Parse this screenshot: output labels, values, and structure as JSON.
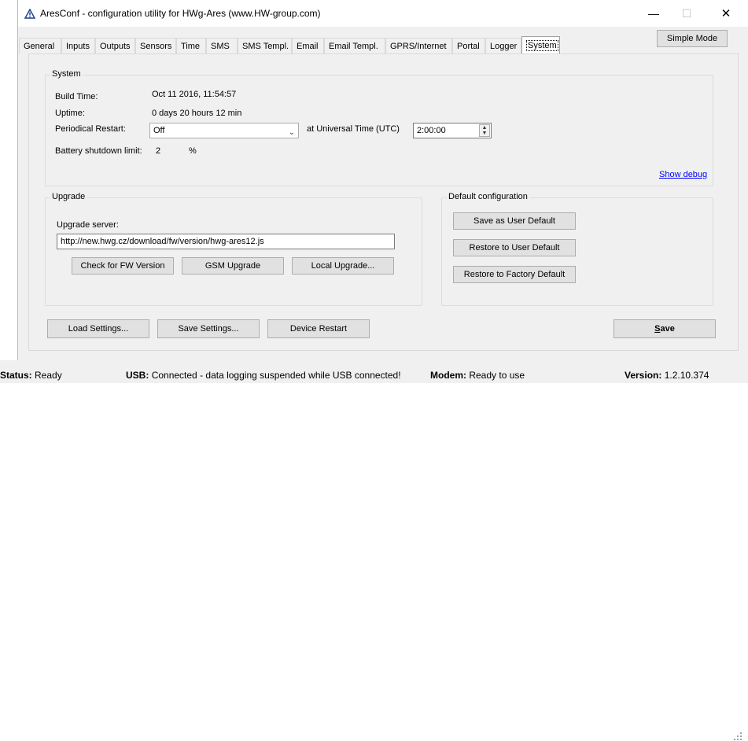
{
  "window": {
    "title": "AresConf - configuration utility for HWg-Ares (www.HW-group.com)",
    "minimize": "—",
    "maximize": "☐",
    "close": "✕"
  },
  "tabs": [
    {
      "label": "General"
    },
    {
      "label": "Inputs"
    },
    {
      "label": "Outputs"
    },
    {
      "label": "Sensors"
    },
    {
      "label": "Time"
    },
    {
      "label": "SMS"
    },
    {
      "label": "SMS Templ."
    },
    {
      "label": "Email"
    },
    {
      "label": "Email Templ."
    },
    {
      "label": "GPRS/Internet"
    },
    {
      "label": "Portal"
    },
    {
      "label": "Logger"
    },
    {
      "label": "System",
      "active": true
    }
  ],
  "simple_mode_label": "Simple Mode",
  "system": {
    "group_title": "System",
    "build_time_label": "Build Time:",
    "build_time_value": "Oct 11 2016, 11:54:57",
    "uptime_label": "Uptime:",
    "uptime_value": "0 days 20 hours 12 min",
    "periodical_restart_label": "Periodical Restart:",
    "periodical_restart_value": "Off",
    "utc_label": "at Universal Time (UTC)",
    "utc_value": "2:00:00",
    "battery_label": "Battery shutdown limit:",
    "battery_value": "2",
    "battery_unit": "%",
    "show_debug": "Show debug"
  },
  "upgrade": {
    "group_title": "Upgrade",
    "server_label": "Upgrade server:",
    "server_value": "http://new.hwg.cz/download/fw/version/hwg-ares12.js",
    "check_fw": "Check for FW Version",
    "gsm_upgrade": "GSM Upgrade",
    "local_upgrade": "Local Upgrade..."
  },
  "default_config": {
    "group_title": "Default configuration",
    "save_user_default": "Save as User Default",
    "restore_user_default": "Restore to User Default",
    "restore_factory_default": "Restore to Factory Default"
  },
  "bottom": {
    "load_settings": "Load Settings...",
    "save_settings": "Save Settings...",
    "device_restart": "Device Restart",
    "save_first": "S",
    "save_rest": "ave"
  },
  "status": {
    "status_label": "Status:",
    "status_value": "Ready",
    "usb_label": "USB:",
    "usb_value": "Connected - data logging suspended while USB connected!",
    "modem_label": "Modem:",
    "modem_value": "Ready to use",
    "version_label": "Version:",
    "version_value": "1.2.10.374"
  },
  "colors": {
    "link": "#0000ff",
    "window_bg": "#f0f0f0",
    "button_bg": "#e1e1e1"
  }
}
